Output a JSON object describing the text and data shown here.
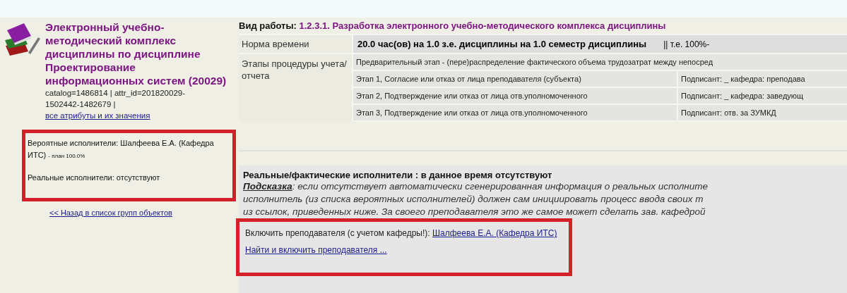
{
  "sidebar": {
    "title": "Электронный учебно-методический комплекс дисциплины по дисциплине Проектирование информационных систем (20029)",
    "meta": "catalog=1486814 | attr_id=201820029-1502442-1482679 |",
    "attributes_link": "все атрибуты и их значения",
    "probable_performers": "Вероятные исполнители: Шалфеева Е.А. (Кафедра ИТС)",
    "plan": "- план 100.0%",
    "real_performers": "Реальные исполнители: отсутствуют",
    "back_link": "<< Назад в список групп объектов"
  },
  "work_type": {
    "label": "Вид работы:",
    "value": "1.2.3.1. Разработка электронного учебно-методического комплекса дисциплины"
  },
  "norm": {
    "label": "Норма времени",
    "value": "20.0 час(ов) на 1.0 з.е. дисциплины на 1.0 семестр дисциплины",
    "extra": "|| т.е. 100%-"
  },
  "stages": {
    "label": "Этапы процедуры учета/отчета",
    "rows": [
      {
        "stage": "Предварительный этап - (пере)распределение фактического объема трудозатрат между непосред"
      },
      {
        "stage": "Этап 1, Согласие или отказ от лица преподавателя (субъекта)",
        "signer": "Подписант: _ кафедра: преподава"
      },
      {
        "stage": "Этап 2, Подтверждение или отказ от лица отв.уполномоченного",
        "signer": "Подписант: _ кафедра: заведующ"
      },
      {
        "stage": "Этап 3, Подтверждение или отказ от лица отв.уполномоченного",
        "signer": "Подписант: отв. за ЗУМКД"
      }
    ]
  },
  "real": {
    "title": "Реальные/фактические исполнители : в данное время отсутствуют",
    "hint_label": "Подсказка",
    "hint_lines": [
      ": если отсутствует автоматически сгенерированная информация о реальных исполните",
      "исполнитель (из списка вероятных исполнителей) должен сам инициировать процесс ввода своих т",
      "из ссылок, приведенных ниже. За своего преподавателя это же самое может сделать зав. кафедрой"
    ],
    "include_label": "Включить преподавателя (с учетом кафедры!):",
    "include_link": "Шалфеева Е.А. (Кафедра ИТС)",
    "find_link": "Найти и включить преподавателя ..."
  }
}
